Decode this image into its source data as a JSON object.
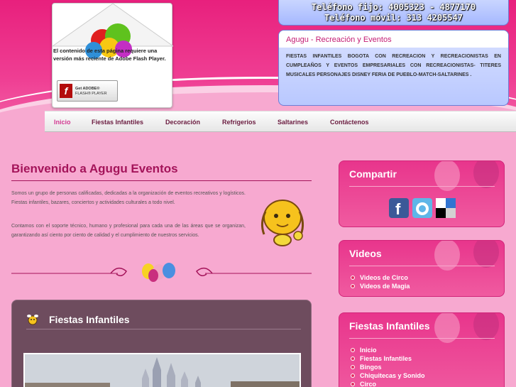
{
  "flash_notice": {
    "message": "El contenido de esta página requiere una versión más reciente de Adobe Flash Player.",
    "badge_line1": "Get ADOBE®",
    "badge_line2": "FLASH® PLAYER"
  },
  "contact": {
    "phone_fixed": "Teléfono fijo: 4005323 - 4877170",
    "phone_mobile": "Teléfono móvil: 313 4205547"
  },
  "company_box": {
    "title": "Agugu - Recreación y Eventos",
    "description": "FIESTAS INFANTILES BOGOTA CON RECREACION Y RECREACIONISTAS EN CUMPLEAÑOS Y EVENTOS EMPRESARIALES CON RECREACIONISTAS- TITERES MUSICALES PERSONAJES DISNEY FERIA DE PUEBLO-MATCH-SALTARINES ."
  },
  "nav": {
    "items": [
      {
        "label": "Inicio",
        "active": true
      },
      {
        "label": "Fiestas Infantiles",
        "active": false
      },
      {
        "label": "Decoración",
        "active": false
      },
      {
        "label": "Refrigerios",
        "active": false
      },
      {
        "label": "Saltarines",
        "active": false
      },
      {
        "label": "Contáctenos",
        "active": false
      }
    ]
  },
  "main": {
    "title": "Bienvenido a Agugu Eventos",
    "paragraph1": "Somos un grupo de personas calificadas, dedicadas a la organización de eventos recreativos y logísticos. Fiestas infantiles, bazares, conciertos y actividades culturales a todo nivel.",
    "paragraph2": "Contamos con el soporte técnico, humano y profesional para cada una de las áreas que se organizan, garantizando así ciento por ciento de calidad y el cumplimiento de nuestros servicios.",
    "panel_title": "Fiestas Infantiles"
  },
  "sidebar": {
    "share": {
      "title": "Compartir",
      "icons": [
        "facebook-icon",
        "twitter-icon",
        "delicious-icon"
      ]
    },
    "videos": {
      "title": "Videos",
      "items": [
        "Videos de Circo",
        "Videos de Magia"
      ]
    },
    "fiestas": {
      "title": "Fiestas Infantiles",
      "items": [
        "Inicio",
        "Fiestas Infantiles",
        "Bingos",
        "Chiquitecas y Sonido",
        "Circo"
      ]
    }
  },
  "colors": {
    "brand_pink": "#e8207d",
    "title_magenta": "#a4145a",
    "nav_active": "#d23a92",
    "panel_bg": "#6e4c5e"
  }
}
